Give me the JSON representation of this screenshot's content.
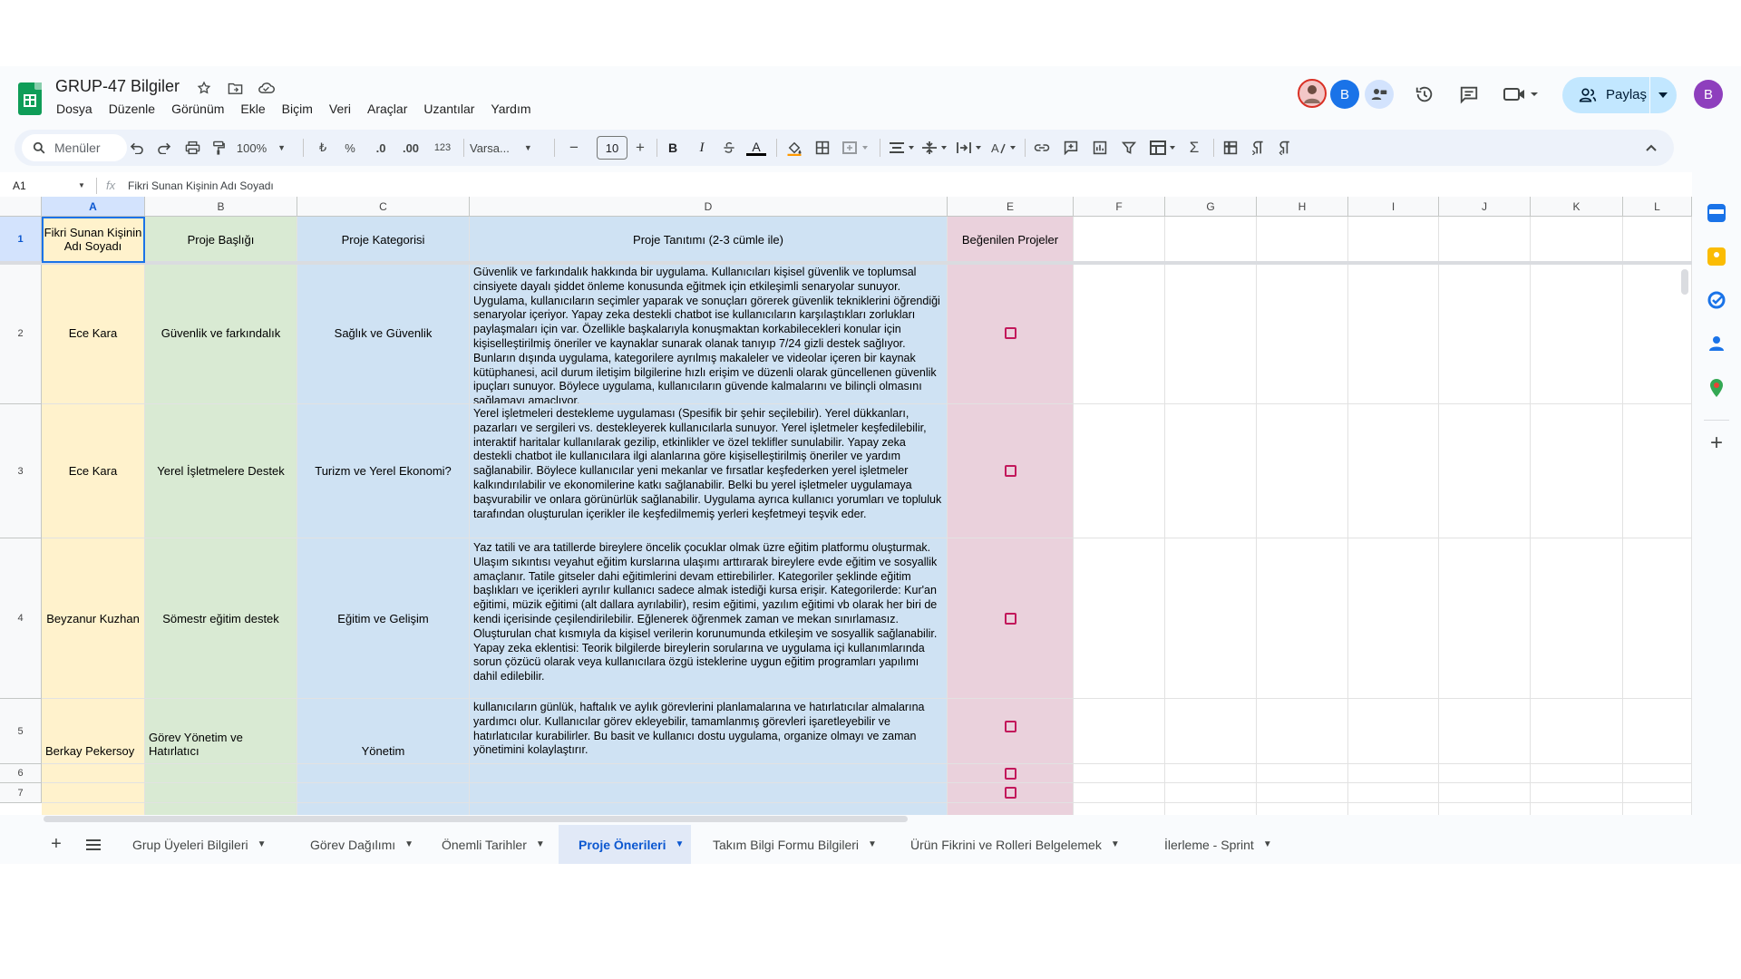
{
  "doc": {
    "title": "GRUP-47 Bilgiler",
    "menus": [
      "Dosya",
      "Düzenle",
      "Görünüm",
      "Ekle",
      "Biçim",
      "Veri",
      "Araçlar",
      "Uzantılar",
      "Yardım"
    ]
  },
  "header_right": {
    "share_label": "Paylaş",
    "avatar_letter": "B",
    "account_letter": "B"
  },
  "toolbar": {
    "search_placeholder": "Menüler",
    "zoom": "100%",
    "currency": "₺",
    "percent": "%",
    "dec_less": ".0",
    "dec_more": ".00",
    "number_format": "123",
    "font": "Varsa...",
    "font_size": "10",
    "minus": "−",
    "plus": "+",
    "bold": "B",
    "italic": "I",
    "sum": "Σ"
  },
  "formula_bar": {
    "name_box": "A1",
    "fx": "fx",
    "content": "Fikri Sunan Kişinin Adı Soyadı"
  },
  "columns": [
    "A",
    "B",
    "C",
    "D",
    "E",
    "F",
    "G",
    "H",
    "I",
    "J",
    "K",
    "L"
  ],
  "rows": [
    "1",
    "2",
    "3",
    "4",
    "5",
    "6",
    "7"
  ],
  "headers": {
    "a": "Fikri Sunan Kişinin Adı Soyadı",
    "b": "Proje Başlığı",
    "c": "Proje Kategorisi",
    "d": "Proje Tanıtımı (2-3 cümle ile)",
    "e": "Beğenilen Projeler"
  },
  "data_rows": [
    {
      "name": "Ece Kara",
      "title": "Güvenlik ve farkındalık",
      "category": "Sağlık ve Güvenlik",
      "description": "Güvenlik ve farkındalık hakkında bir uygulama. Kullanıcıları kişisel güvenlik ve toplumsal cinsiyete dayalı şiddet önleme konusunda eğitmek için etkileşimli senaryolar sunuyor. Uygulama, kullanıcıların seçimler yaparak ve sonuçları görerek güvenlik tekniklerini öğrendiği senaryolar içeriyor. Yapay zeka destekli chatbot ise kullanıcıların karşılaştıkları zorlukları paylaşmaları için var. Özellikle başkalarıyla konuşmaktan korkabilecekleri konular için kişiselleştirilmiş öneriler ve kaynaklar sunarak olanak tanıyıp 7/24 gizli destek sağlıyor. Bunların dışında uygulama, kategorilere ayrılmış makaleler ve videolar içeren bir kaynak kütüphanesi, acil durum iletişim bilgilerine hızlı erişim ve düzenli olarak güncellenen güvenlik ipuçları sunuyor. Böylece uygulama, kullanıcıların güvende kalmalarını ve bilinçli olmasını sağlamayı amaçlıyor.",
      "liked": false
    },
    {
      "name": "Ece Kara",
      "title": "Yerel İşletmelere Destek",
      "category": "Turizm ve Yerel Ekonomi?",
      "description": "Yerel işletmeleri destekleme uygulaması (Spesifik bir şehir seçilebilir). Yerel dükkanları, pazarları ve sergileri vs. destekleyerek kullanıcılarla sunuyor. Yerel işletmeler keşfedilebilir, interaktif haritalar kullanılarak gezilip, etkinlikler ve özel teklifler sunulabilir. Yapay zeka destekli chatbot ile kullanıcılara ilgi alanlarına göre kişiselleştirilmiş öneriler ve yardım sağlanabilir. Böylece kullanıcılar yeni mekanlar ve fırsatlar keşfederken yerel işletmeler kalkındırılabilir ve ekonomilerine katkı sağlanabilir. Belki bu yerel işletmeler uygulamaya başvurabilir ve onlara görünürlük sağlanabilir. Uygulama ayrıca kullanıcı yorumları ve topluluk tarafından oluşturulan içerikler ile keşfedilmemiş yerleri keşfetmeyi teşvik eder.",
      "liked": false
    },
    {
      "name": "Beyzanur Kuzhan",
      "title": "Sömestr eğitim destek",
      "category": "Eğitim ve Gelişim",
      "description": "Yaz tatili ve ara tatillerde bireylere öncelik çocuklar olmak üzre eğitim platformu oluşturmak. Ulaşım sıkıntısı veyahut eğitim kurslarına ulaşımı arttırarak bireylere evde eğitim ve sosyallik amaçlanır. Tatile gitseler dahi eğitimlerini devam ettirebilirler. Kategoriler şeklinde eğitim başlıkları ve içerikleri ayrılır kullanıcı sadece almak istediği kursa erişir. Kategorilerde: Kur'an eğitimi, müzik eğitimi (alt dallara ayrılabilir), resim eğitimi, yazılım eğitimi vb olarak her biri de kendi içerisinde çeşilendirilebilir. Eğlenerek öğrenmek zaman ve mekan sınırlamasız. Oluşturulan chat kısmıyla da kişisel verilerin korunumunda etkileşim ve sosyallik sağlanabilir. Yapay zeka eklentisi: Teorik bilgilerde bireylerin sorularına ve uygulama içi kullanımlarında sorun çözücü olarak veya kullanıcılara özgü isteklerine uygun eğitim programları yapılımı dahil edilebilir.",
      "liked": false
    },
    {
      "name": "Berkay Pekersoy",
      "title": "Görev Yönetim ve Hatırlatıcı",
      "category": "Yönetim",
      "description": "kullanıcıların günlük, haftalık ve aylık görevlerini planlamalarına ve hatırlatıcılar almalarına yardımcı olur. Kullanıcılar görev ekleyebilir, tamamlanmış görevleri işaretleyebilir ve hatırlatıcılar kurabilirler. Bu basit ve kullanıcı dostu uygulama, organize olmayı ve zaman yönetimini kolaylaştırır.",
      "liked": false
    }
  ],
  "sheet_tabs": [
    {
      "label": "Grup Üyeleri Bilgileri",
      "active": false
    },
    {
      "label": "Görev Dağılımı",
      "active": false
    },
    {
      "label": "Önemli Tarihler",
      "active": false
    },
    {
      "label": "Proje Önerileri",
      "active": true
    },
    {
      "label": "Takım Bilgi Formu Bilgileri",
      "active": false
    },
    {
      "label": "Ürün Fikrini ve Rolleri Belgelemek",
      "active": false
    },
    {
      "label": "İlerleme - Sprint",
      "active": false
    }
  ],
  "colors": {
    "accent": "#0b57d0",
    "sheets_green": "#0f9d58",
    "col_a": "#fff2cc",
    "col_b": "#d9ead3",
    "col_cd": "#cfe2f3",
    "col_e": "#ead1dc",
    "checkbox": "#c2185b"
  }
}
